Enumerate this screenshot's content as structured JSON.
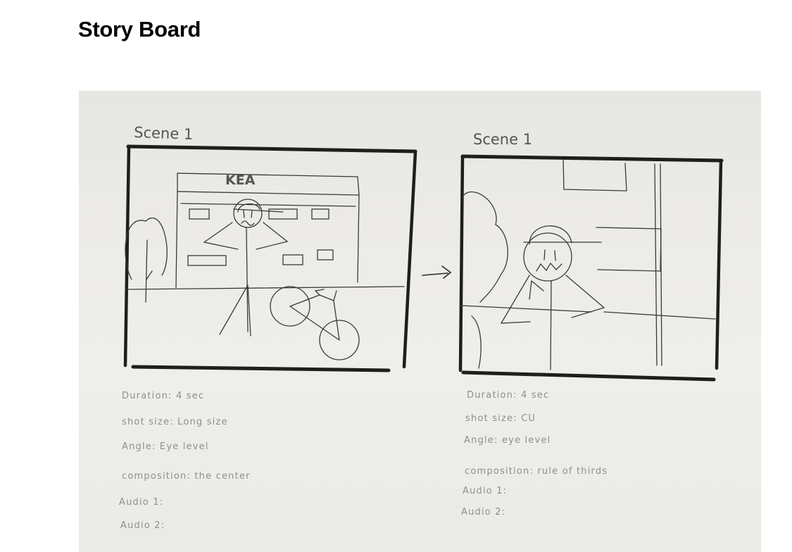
{
  "page": {
    "title": "Story Board"
  },
  "storyboard": {
    "panels": [
      {
        "scene_label": "Scene 1",
        "sign_text": "KEA",
        "notes": [
          "Duration: 4 sec",
          "shot size: Long size",
          "Angle: Eye level",
          "composition: the center",
          "Audio 1:",
          "Audio 2:"
        ]
      },
      {
        "scene_label": "Scene 1",
        "notes": [
          "Duration: 4 sec",
          "shot size: CU",
          "Angle: eye level",
          "composition: rule of thirds",
          "Audio 1:",
          "Audio 2:"
        ]
      }
    ]
  }
}
